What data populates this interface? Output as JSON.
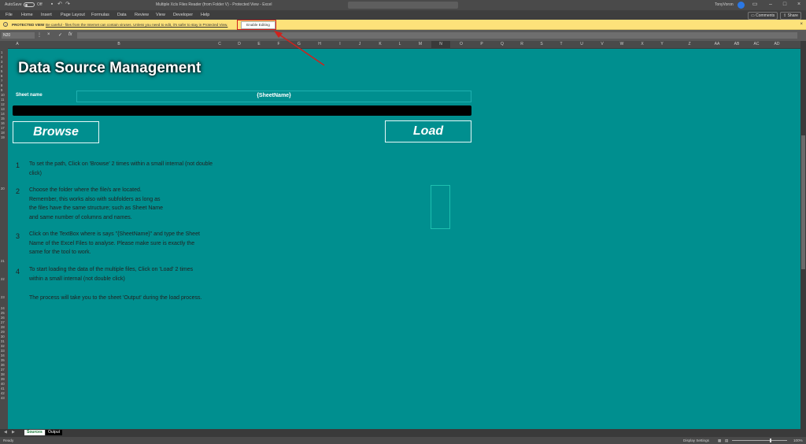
{
  "titlebar": {
    "autosave_label": "AutoSave",
    "autosave_state": "Off",
    "document_title": "Multiple Xcls Files Reader (from Folder V) - Protected View - Excel",
    "user_name": "TonyVoron"
  },
  "ribbon": {
    "tabs": [
      "File",
      "Home",
      "Insert",
      "Page Layout",
      "Formulas",
      "Data",
      "Review",
      "View",
      "Developer",
      "Help"
    ],
    "comments_label": "Comments",
    "share_label": "Share"
  },
  "protected_view": {
    "label": "PROTECTED VIEW",
    "message": "Be careful - files from the Internet can contain viruses. Unless you need to edit, it's safer to stay in Protected View.",
    "enable_button": "Enable Editing",
    "highlight_color": "#d0211c"
  },
  "formula_bar": {
    "name_box": "N20",
    "formula": ""
  },
  "columns": [
    "A",
    "B",
    "C",
    "D",
    "E",
    "F",
    "G",
    "H",
    "I",
    "J",
    "K",
    "L",
    "M",
    "N",
    "O",
    "P",
    "Q",
    "R",
    "S",
    "T",
    "U",
    "V",
    "W",
    "X",
    "Y",
    "Z",
    "AA",
    "AB",
    "AC",
    "AD"
  ],
  "rows": [
    "1",
    "2",
    "3",
    "4",
    "5",
    "6",
    "7",
    "8",
    "9",
    "10",
    "11",
    "12",
    "13",
    "14",
    "15",
    "16",
    "17",
    "18",
    "19",
    "20",
    "21",
    "22",
    "23",
    "24",
    "25",
    "26",
    "27",
    "28",
    "29",
    "30",
    "31",
    "32",
    "33",
    "34",
    "35",
    "36",
    "37",
    "38",
    "39",
    "40",
    "41",
    "42",
    "43"
  ],
  "sheet": {
    "background": "#008f8f",
    "title": "Data Source Management",
    "sheet_name_label": "Sheet name",
    "sheet_name_value": "{SheetName}",
    "browse_button": "Browse",
    "load_button": "Load",
    "steps": [
      {
        "num": "1",
        "text": "To set the path, Click on 'Browse' 2 times within a small internal (not double click)"
      },
      {
        "num": "2",
        "text": "Choose the folder where the file/s are located. Remember, this works also with subfolders as long as the files have the same structure; such as Sheet Name and same number of columns and names."
      },
      {
        "num": "3",
        "text": "Click on the TextBox where is says \"{SheetName}\" and type the Sheet Name of the Excel Files to analyse. Please make sure is exactly the same for the tool to work."
      },
      {
        "num": "4",
        "text": "To start loading the data of the multiple files, Click on 'Load' 2 times within a small internal (not double click)"
      }
    ],
    "note": "The process will take you to the sheet 'Output' during the load process."
  },
  "sheet_tabs": [
    "Sources",
    "Output"
  ],
  "statusbar": {
    "ready": "Ready",
    "display_settings": "Display Settings",
    "zoom": "100%"
  }
}
